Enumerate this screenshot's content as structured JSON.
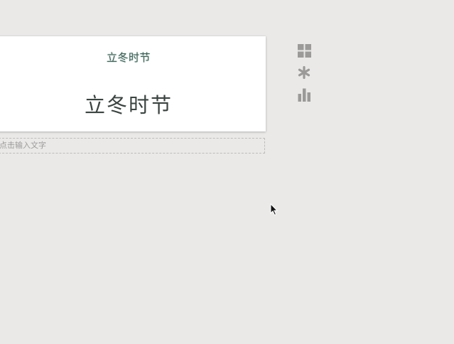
{
  "card": {
    "subtitle": "立冬时节",
    "title": "立冬时节"
  },
  "caption": {
    "placeholder": "点击输入文字"
  },
  "toolbar": {
    "icons": [
      "layout-grid-icon",
      "asterisk-icon",
      "bar-chart-icon"
    ],
    "icon_color": "#9b9a99"
  },
  "colors": {
    "background": "#eae9e8",
    "card": "#ffffff",
    "subtitle_glow": "#9dc6bb"
  }
}
